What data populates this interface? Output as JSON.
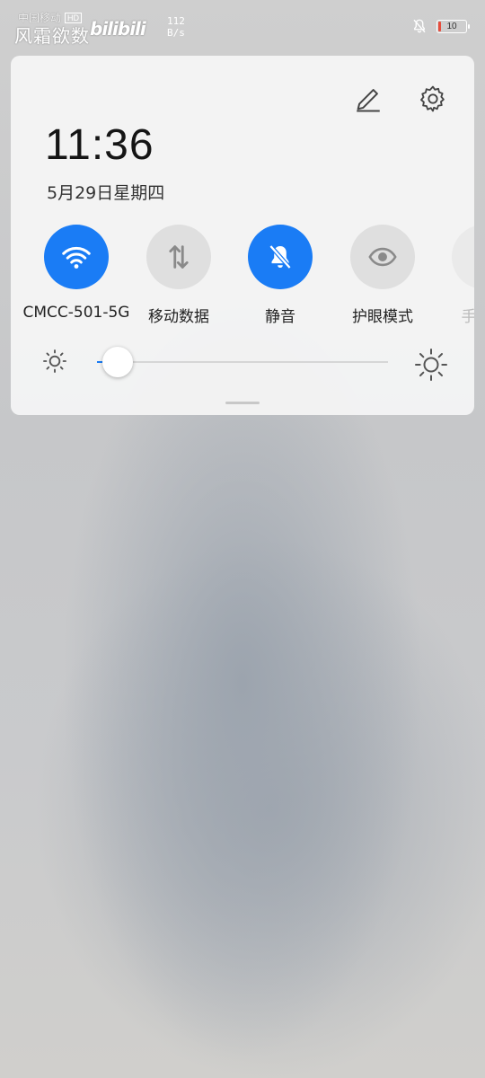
{
  "status_bar": {
    "carrier": "中国移动",
    "hd_badge": "HD",
    "watermark": "风霜欲数",
    "logo": "bilibili",
    "net_speed_value": "112",
    "net_speed_unit": "B/s",
    "battery_level": "10",
    "battery_fraction": 0.1,
    "icons": [
      "bell-off-icon",
      "battery-icon"
    ]
  },
  "panel": {
    "time": "11:36",
    "date": "5月29日星期四",
    "top_icons": [
      "edit-pencil-icon",
      "settings-gear-icon"
    ],
    "tiles": [
      {
        "label": "CMCC-501-5G",
        "icon": "wifi-icon",
        "state": "on"
      },
      {
        "label": "移动数据",
        "icon": "mobile-data-icon",
        "state": "off"
      },
      {
        "label": "静音",
        "icon": "bell-off-icon",
        "state": "on"
      },
      {
        "label": "护眼模式",
        "icon": "eye-icon",
        "state": "off"
      },
      {
        "label": "手电筒",
        "icon": "flashlight-icon",
        "state": "off"
      }
    ],
    "brightness": {
      "level": 0.07,
      "icons": [
        "brightness-low-icon",
        "brightness-high-icon"
      ]
    }
  },
  "colors": {
    "accent": "#1a7cf5",
    "tile_off": "#dfdfdf",
    "panel_bg": "#f4f4f4",
    "battery_low": "#e74c3c"
  }
}
